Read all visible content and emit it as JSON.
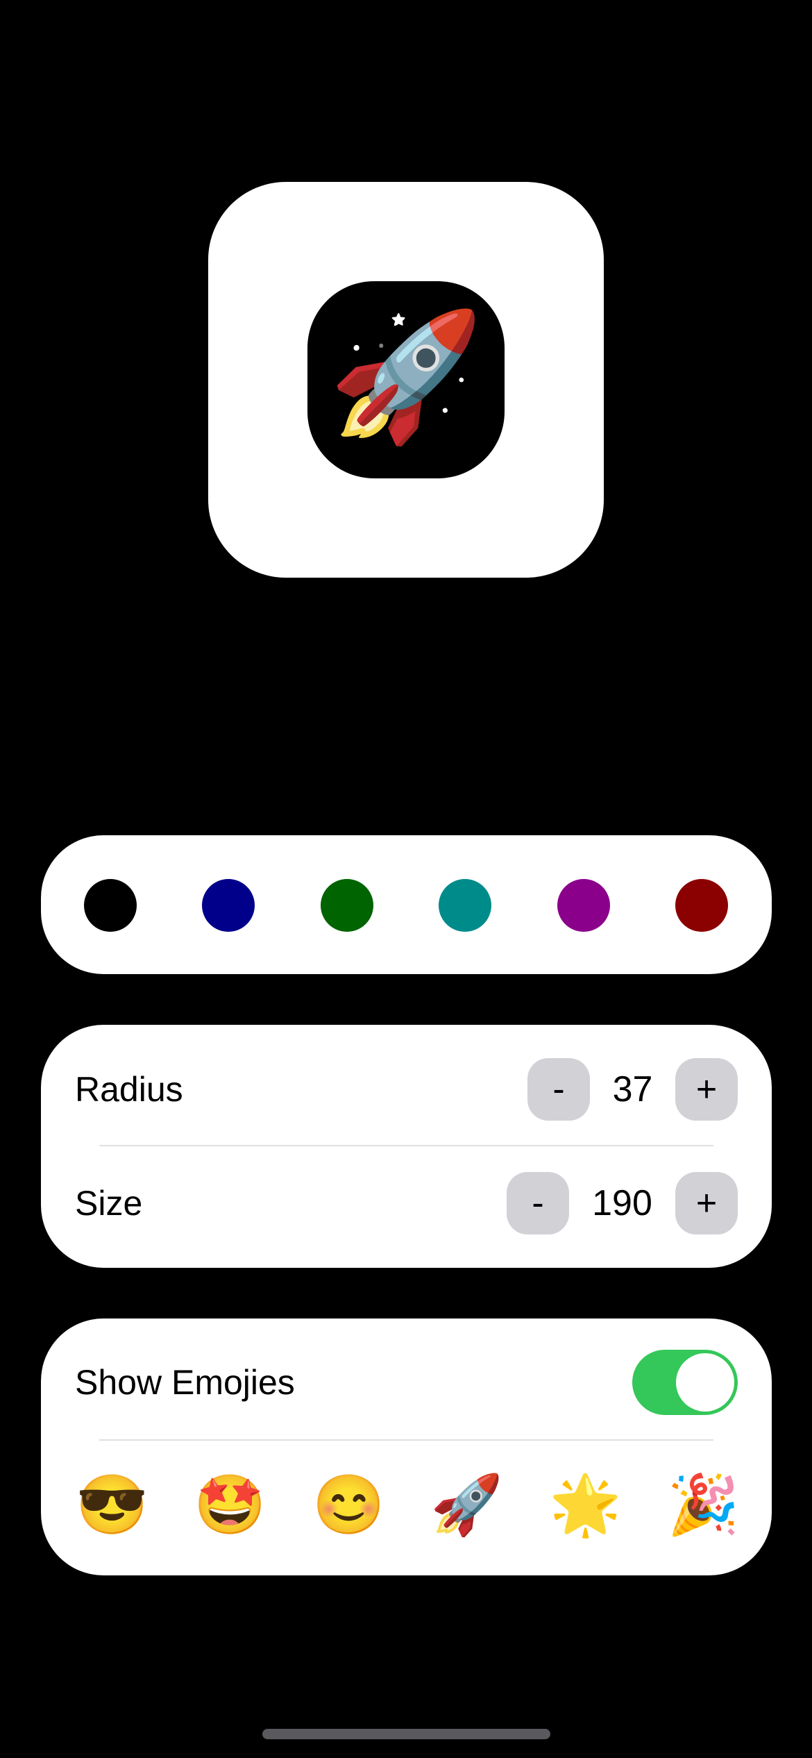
{
  "preview": {
    "emoji": "🚀",
    "outer_color": "#ffffff",
    "inner_color": "#000000"
  },
  "palette": {
    "colors": [
      "#000000",
      "#00008b",
      "#006400",
      "#008b8b",
      "#8b008b",
      "#8b0000"
    ]
  },
  "controls": {
    "radius": {
      "label": "Radius",
      "decrement_label": "-",
      "value": "37",
      "increment_label": "+"
    },
    "size": {
      "label": "Size",
      "decrement_label": "-",
      "value": "190",
      "increment_label": "+"
    }
  },
  "emojis": {
    "toggle_label": "Show Emojies",
    "toggle_on": true,
    "toggle_color": "#34c759",
    "items": [
      "😎",
      "🤩",
      "😊",
      "🚀",
      "🌟",
      "🎉"
    ]
  }
}
